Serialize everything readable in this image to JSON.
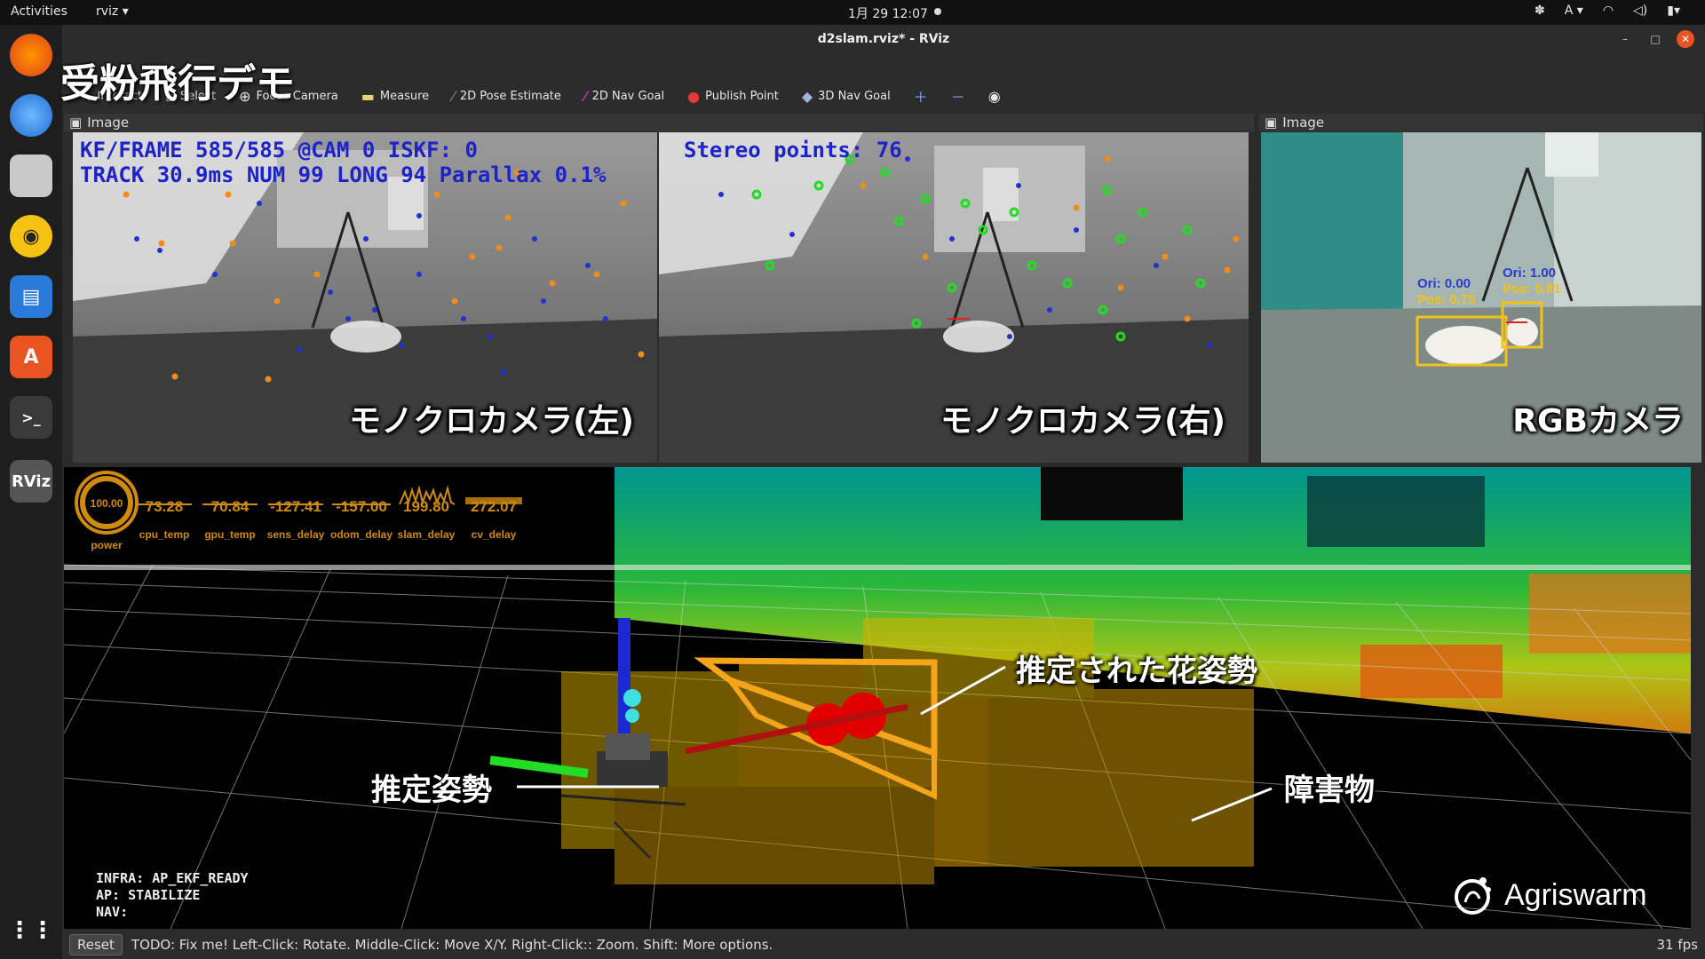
{
  "topbar": {
    "activities": "Activities",
    "app_menu": "rviz ▾",
    "clock": "1月 29  12:07",
    "lang": "A ▾"
  },
  "window": {
    "title": "d2slam.rviz* - RViz"
  },
  "overlay_title": "受粉飛行デモ",
  "toolbar": {
    "items": [
      "Interact",
      "Select",
      "Focus Camera",
      "Measure",
      "2D Pose Estimate",
      "2D Nav Goal",
      "Publish Point",
      "3D Nav Goal"
    ]
  },
  "panels": {
    "left_title": "Image",
    "right_title": "Image"
  },
  "cams": {
    "left_line1": "KF/FRAME 585/585 @CAM 0 ISKF: 0",
    "left_line2": "TRACK 30.9ms NUM 99 LONG 94 Parallax 0.1%",
    "right_line1": "Stereo points: 76",
    "left_label": "モノクロカメラ(左)",
    "right_label": "モノクロカメラ(右)",
    "rgb_label": "RGBカメラ",
    "det1_ori": "Ori: 0.00",
    "det1_pos": "Pos: 0.75",
    "det2_ori": "Ori: 1.00",
    "det2_pos": "Pos: 0.81"
  },
  "gauges": {
    "power": {
      "value": "100.00",
      "label": "power"
    },
    "items": [
      {
        "value": "73.28",
        "label": "cpu_temp"
      },
      {
        "value": "70.84",
        "label": "gpu_temp"
      },
      {
        "value": "-127.41",
        "label": "sens_delay"
      },
      {
        "value": "-157.00",
        "label": "odom_delay"
      },
      {
        "value": "199.80",
        "label": "slam_delay"
      },
      {
        "value": "272.07",
        "label": "cv_delay"
      }
    ]
  },
  "infra_text": "INFRA: AP_EKF_READY\nAP: STABILIZE\nNAV:",
  "annotations": {
    "flower_pose": "推定された花姿勢",
    "est_pose": "推定姿勢",
    "obstacle": "障害物"
  },
  "brand": "Agriswarm",
  "status": {
    "reset": "Reset",
    "hint": "TODO: Fix me! Left-Click: Rotate. Middle-Click: Move X/Y. Right-Click:: Zoom. Shift: More options.",
    "fps": "31 fps"
  },
  "colors": {
    "accent": "#e95420",
    "gauge": "#d08a10",
    "hud_blue": "#1e23c8"
  }
}
